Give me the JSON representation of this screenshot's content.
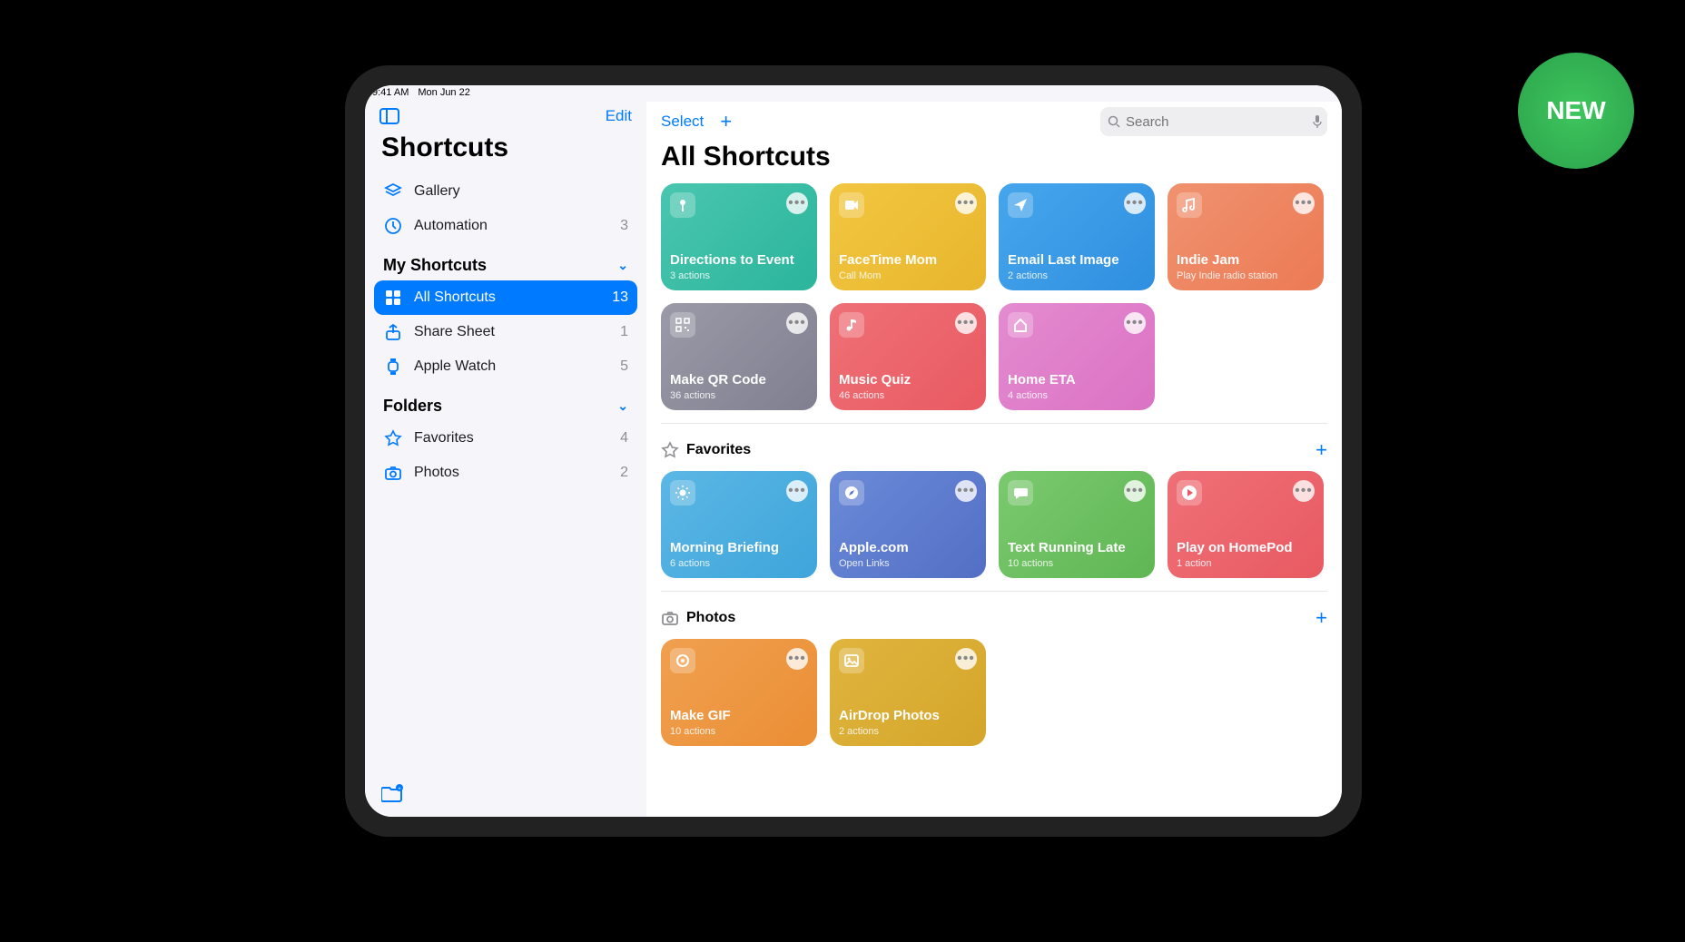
{
  "badge": "NEW",
  "status": {
    "time": "9:41 AM",
    "date": "Mon Jun 22"
  },
  "sidebar": {
    "edit": "Edit",
    "title": "Shortcuts",
    "nav": [
      {
        "label": "Gallery",
        "count": ""
      },
      {
        "label": "Automation",
        "count": "3"
      }
    ],
    "section1": "My Shortcuts",
    "my": [
      {
        "label": "All Shortcuts",
        "count": "13",
        "selected": true
      },
      {
        "label": "Share Sheet",
        "count": "1"
      },
      {
        "label": "Apple Watch",
        "count": "5"
      }
    ],
    "section2": "Folders",
    "folders": [
      {
        "label": "Favorites",
        "count": "4"
      },
      {
        "label": "Photos",
        "count": "2"
      }
    ]
  },
  "main": {
    "select": "Select",
    "search_placeholder": "Search",
    "title": "All Shortcuts",
    "groups": [
      {
        "name": "",
        "icon": "",
        "tiles": [
          {
            "title": "Directions to Event",
            "sub": "3 actions",
            "grad": "g-teal",
            "icon": "pin"
          },
          {
            "title": "FaceTime Mom",
            "sub": "Call Mom",
            "grad": "g-yellow",
            "icon": "video"
          },
          {
            "title": "Email Last Image",
            "sub": "2 actions",
            "grad": "g-blue",
            "icon": "plane"
          },
          {
            "title": "Indie Jam",
            "sub": "Play Indie radio station",
            "grad": "g-orange",
            "icon": "music"
          },
          {
            "title": "Make QR Code",
            "sub": "36 actions",
            "grad": "g-gray",
            "icon": "qr"
          },
          {
            "title": "Music Quiz",
            "sub": "46 actions",
            "grad": "g-red",
            "icon": "note"
          },
          {
            "title": "Home ETA",
            "sub": "4 actions",
            "grad": "g-pink",
            "icon": "home"
          }
        ]
      },
      {
        "name": "Favorites",
        "icon": "star",
        "tiles": [
          {
            "title": "Morning Briefing",
            "sub": "6 actions",
            "grad": "g-sky",
            "icon": "sun"
          },
          {
            "title": "Apple.com",
            "sub": "Open Links",
            "grad": "g-indigo",
            "icon": "safari"
          },
          {
            "title": "Text Running Late",
            "sub": "10 actions",
            "grad": "g-green",
            "icon": "chat"
          },
          {
            "title": "Play on HomePod",
            "sub": "1 action",
            "grad": "g-red",
            "icon": "play"
          }
        ]
      },
      {
        "name": "Photos",
        "icon": "camera",
        "tiles": [
          {
            "title": "Make GIF",
            "sub": "10 actions",
            "grad": "g-orange2",
            "icon": "target"
          },
          {
            "title": "AirDrop Photos",
            "sub": "2 actions",
            "grad": "g-gold",
            "icon": "image"
          }
        ]
      }
    ]
  }
}
